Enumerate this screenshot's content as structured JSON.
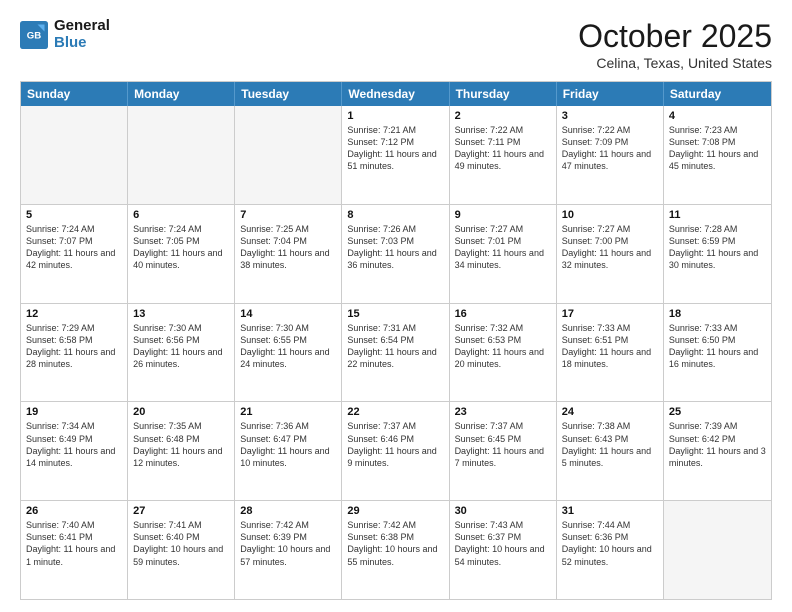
{
  "logo": {
    "line1": "General",
    "line2": "Blue"
  },
  "title": "October 2025",
  "location": "Celina, Texas, United States",
  "headers": [
    "Sunday",
    "Monday",
    "Tuesday",
    "Wednesday",
    "Thursday",
    "Friday",
    "Saturday"
  ],
  "rows": [
    [
      {
        "day": "",
        "text": ""
      },
      {
        "day": "",
        "text": ""
      },
      {
        "day": "",
        "text": ""
      },
      {
        "day": "1",
        "text": "Sunrise: 7:21 AM\nSunset: 7:12 PM\nDaylight: 11 hours and 51 minutes."
      },
      {
        "day": "2",
        "text": "Sunrise: 7:22 AM\nSunset: 7:11 PM\nDaylight: 11 hours and 49 minutes."
      },
      {
        "day": "3",
        "text": "Sunrise: 7:22 AM\nSunset: 7:09 PM\nDaylight: 11 hours and 47 minutes."
      },
      {
        "day": "4",
        "text": "Sunrise: 7:23 AM\nSunset: 7:08 PM\nDaylight: 11 hours and 45 minutes."
      }
    ],
    [
      {
        "day": "5",
        "text": "Sunrise: 7:24 AM\nSunset: 7:07 PM\nDaylight: 11 hours and 42 minutes."
      },
      {
        "day": "6",
        "text": "Sunrise: 7:24 AM\nSunset: 7:05 PM\nDaylight: 11 hours and 40 minutes."
      },
      {
        "day": "7",
        "text": "Sunrise: 7:25 AM\nSunset: 7:04 PM\nDaylight: 11 hours and 38 minutes."
      },
      {
        "day": "8",
        "text": "Sunrise: 7:26 AM\nSunset: 7:03 PM\nDaylight: 11 hours and 36 minutes."
      },
      {
        "day": "9",
        "text": "Sunrise: 7:27 AM\nSunset: 7:01 PM\nDaylight: 11 hours and 34 minutes."
      },
      {
        "day": "10",
        "text": "Sunrise: 7:27 AM\nSunset: 7:00 PM\nDaylight: 11 hours and 32 minutes."
      },
      {
        "day": "11",
        "text": "Sunrise: 7:28 AM\nSunset: 6:59 PM\nDaylight: 11 hours and 30 minutes."
      }
    ],
    [
      {
        "day": "12",
        "text": "Sunrise: 7:29 AM\nSunset: 6:58 PM\nDaylight: 11 hours and 28 minutes."
      },
      {
        "day": "13",
        "text": "Sunrise: 7:30 AM\nSunset: 6:56 PM\nDaylight: 11 hours and 26 minutes."
      },
      {
        "day": "14",
        "text": "Sunrise: 7:30 AM\nSunset: 6:55 PM\nDaylight: 11 hours and 24 minutes."
      },
      {
        "day": "15",
        "text": "Sunrise: 7:31 AM\nSunset: 6:54 PM\nDaylight: 11 hours and 22 minutes."
      },
      {
        "day": "16",
        "text": "Sunrise: 7:32 AM\nSunset: 6:53 PM\nDaylight: 11 hours and 20 minutes."
      },
      {
        "day": "17",
        "text": "Sunrise: 7:33 AM\nSunset: 6:51 PM\nDaylight: 11 hours and 18 minutes."
      },
      {
        "day": "18",
        "text": "Sunrise: 7:33 AM\nSunset: 6:50 PM\nDaylight: 11 hours and 16 minutes."
      }
    ],
    [
      {
        "day": "19",
        "text": "Sunrise: 7:34 AM\nSunset: 6:49 PM\nDaylight: 11 hours and 14 minutes."
      },
      {
        "day": "20",
        "text": "Sunrise: 7:35 AM\nSunset: 6:48 PM\nDaylight: 11 hours and 12 minutes."
      },
      {
        "day": "21",
        "text": "Sunrise: 7:36 AM\nSunset: 6:47 PM\nDaylight: 11 hours and 10 minutes."
      },
      {
        "day": "22",
        "text": "Sunrise: 7:37 AM\nSunset: 6:46 PM\nDaylight: 11 hours and 9 minutes."
      },
      {
        "day": "23",
        "text": "Sunrise: 7:37 AM\nSunset: 6:45 PM\nDaylight: 11 hours and 7 minutes."
      },
      {
        "day": "24",
        "text": "Sunrise: 7:38 AM\nSunset: 6:43 PM\nDaylight: 11 hours and 5 minutes."
      },
      {
        "day": "25",
        "text": "Sunrise: 7:39 AM\nSunset: 6:42 PM\nDaylight: 11 hours and 3 minutes."
      }
    ],
    [
      {
        "day": "26",
        "text": "Sunrise: 7:40 AM\nSunset: 6:41 PM\nDaylight: 11 hours and 1 minute."
      },
      {
        "day": "27",
        "text": "Sunrise: 7:41 AM\nSunset: 6:40 PM\nDaylight: 10 hours and 59 minutes."
      },
      {
        "day": "28",
        "text": "Sunrise: 7:42 AM\nSunset: 6:39 PM\nDaylight: 10 hours and 57 minutes."
      },
      {
        "day": "29",
        "text": "Sunrise: 7:42 AM\nSunset: 6:38 PM\nDaylight: 10 hours and 55 minutes."
      },
      {
        "day": "30",
        "text": "Sunrise: 7:43 AM\nSunset: 6:37 PM\nDaylight: 10 hours and 54 minutes."
      },
      {
        "day": "31",
        "text": "Sunrise: 7:44 AM\nSunset: 6:36 PM\nDaylight: 10 hours and 52 minutes."
      },
      {
        "day": "",
        "text": ""
      }
    ]
  ]
}
